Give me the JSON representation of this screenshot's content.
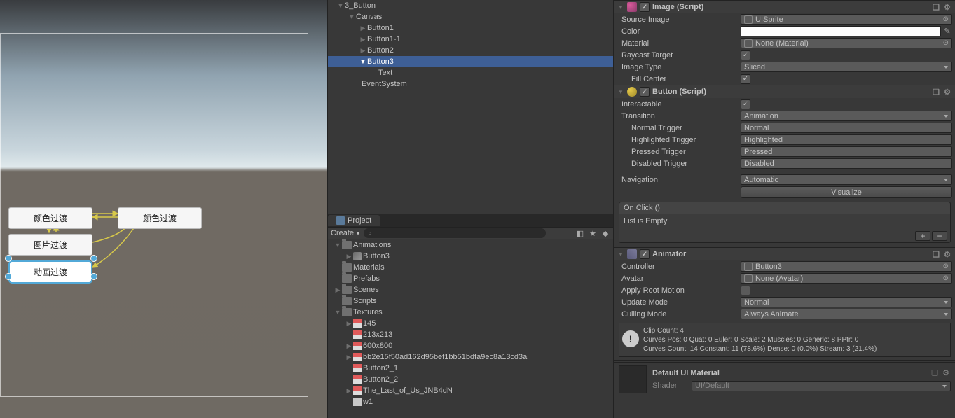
{
  "hierarchy": {
    "root": "3_Button",
    "canvas": "Canvas",
    "items": [
      "Button1",
      "Button1-1",
      "Button2",
      "Button3",
      "Text"
    ],
    "selected": "Button3",
    "event_system": "EventSystem"
  },
  "project": {
    "tab": "Project",
    "create": "Create",
    "folders": {
      "animations": "Animations",
      "animations_child": "Button3",
      "materials": "Materials",
      "prefabs": "Prefabs",
      "scenes": "Scenes",
      "scripts": "Scripts",
      "textures": "Textures",
      "tex_children": [
        "145",
        "213x213",
        "600x800",
        "bb2e15f50ad162d95bef1bb51bdfa9ec8a13cd3a",
        "Button2_1",
        "Button2_2",
        "The_Last_of_Us_JNB4dN",
        "w1"
      ]
    }
  },
  "scene_buttons": {
    "b1": "颜色过渡",
    "b2": "颜色过渡",
    "b3": "图片过渡",
    "b4": "动画过渡"
  },
  "inspector": {
    "image": {
      "title": "Image (Script)",
      "source_image": "Source Image",
      "source_image_value": "UISprite",
      "color": "Color",
      "material": "Material",
      "material_value": "None (Material)",
      "raycast_target": "Raycast Target",
      "image_type": "Image Type",
      "image_type_value": "Sliced",
      "fill_center": "Fill Center"
    },
    "button": {
      "title": "Button (Script)",
      "interactable": "Interactable",
      "transition": "Transition",
      "transition_value": "Animation",
      "normal_trigger": "Normal Trigger",
      "normal_trigger_value": "Normal",
      "highlighted_trigger": "Highlighted Trigger",
      "highlighted_trigger_value": "Highlighted",
      "pressed_trigger": "Pressed Trigger",
      "pressed_trigger_value": "Pressed",
      "disabled_trigger": "Disabled Trigger",
      "disabled_trigger_value": "Disabled",
      "navigation": "Navigation",
      "navigation_value": "Automatic",
      "visualize": "Visualize",
      "onclick_header": "On Click ()",
      "onclick_empty": "List is Empty"
    },
    "animator": {
      "title": "Animator",
      "controller": "Controller",
      "controller_value": "Button3",
      "avatar": "Avatar",
      "avatar_value": "None (Avatar)",
      "apply_root_motion": "Apply Root Motion",
      "update_mode": "Update Mode",
      "update_mode_value": "Normal",
      "culling_mode": "Culling Mode",
      "culling_mode_value": "Always Animate",
      "info_line1": "Clip Count: 4",
      "info_line2": "Curves Pos: 0 Quat: 0 Euler: 0 Scale: 2 Muscles: 0 Generic: 8 PPtr: 0",
      "info_line3": "Curves Count: 14 Constant: 11 (78.6%) Dense: 0 (0.0%) Stream: 3 (21.4%)"
    },
    "material": {
      "title": "Default UI Material",
      "shader_label": "Shader",
      "shader_value": "UI/Default"
    }
  }
}
